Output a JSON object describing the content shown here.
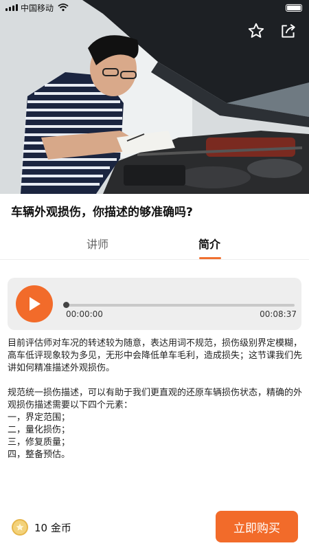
{
  "status_bar": {
    "carrier": "中国移动"
  },
  "hero": {
    "image_desc": "man inspecting car engine with clipboard",
    "icons": [
      "star-icon",
      "share-icon"
    ]
  },
  "course": {
    "title": "车辆外观损伤，你描述的够准确吗?"
  },
  "tabs": [
    {
      "label": "讲师",
      "active": false
    },
    {
      "label": "简介",
      "active": true
    }
  ],
  "player": {
    "current_time": "00:00:00",
    "total_time": "00:08:37",
    "progress": 0,
    "accent": "#f26b2a"
  },
  "description": {
    "paragraph1": "目前评估师对车况的转述较为随意，表达用词不规范，损伤级别界定模糊，高车低评现象较为多见，无形中会降低单车毛利，造成损失；这节课我们先讲如何精准描述外观损伤。",
    "paragraph2": "规范统一损伤描述，可以有助于我们更直观的还原车辆损伤状态，精确的外观损伤描述需要以下四个元素：",
    "items": [
      "一，界定范围；",
      "二，量化损伤；",
      "三，修复质量；",
      "四，整备预估。"
    ]
  },
  "purchase": {
    "price": "10 金币",
    "buy_label": "立即购买",
    "accent": "#f26b2a"
  }
}
